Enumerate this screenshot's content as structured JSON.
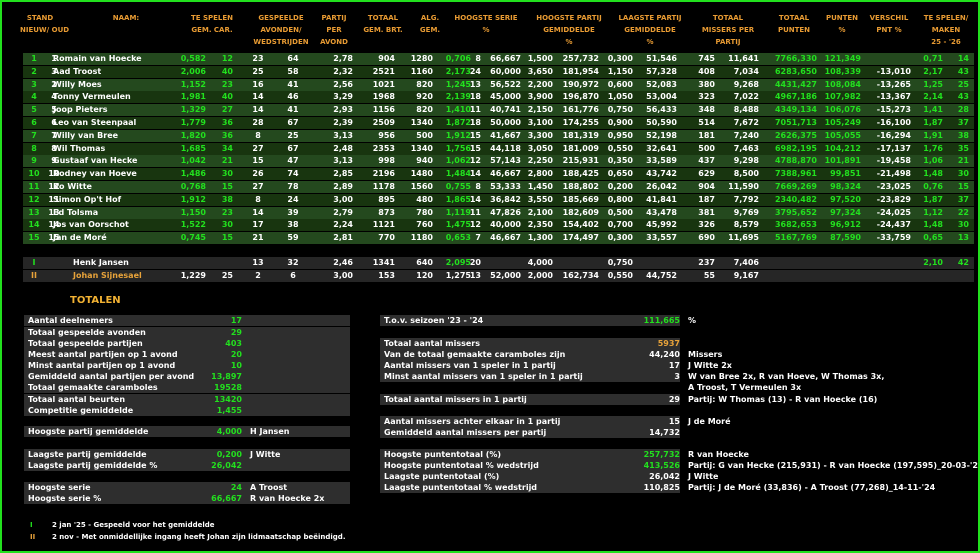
{
  "headers": {
    "stand": [
      "STAND",
      "NIEUW/ OUD"
    ],
    "naam": [
      "NAAM:"
    ],
    "te_spelen": [
      "TE SPELEN",
      "GEM.     CAR."
    ],
    "gespeelde": [
      "GESPEELDE",
      "AVONDEN/",
      "WEDSTRIJDEN"
    ],
    "partij": [
      "PARTIJ",
      "PER",
      "AVOND"
    ],
    "totaal": [
      "TOTAAL",
      "GEM.   BRT."
    ],
    "alg": [
      "ALG.",
      "GEM."
    ],
    "hoogste_serie": [
      "HOOGSTE SERIE",
      "%"
    ],
    "hoogste_partij": [
      "HOOGSTE PARTIJ",
      "GEMIDDELDE",
      "%"
    ],
    "laagste_partij": [
      "LAAGSTE PARTIJ",
      "GEMIDDELDE",
      "%"
    ],
    "totaal_missers": [
      "TOTAAL",
      "MISSERS    PER",
      "PARTIJ"
    ],
    "totaal_punten": [
      "TOTAAL",
      "PUNTEN"
    ],
    "punten_pct": [
      "PUNTEN",
      "%"
    ],
    "verschil": [
      "VERSCHIL",
      "PNT %"
    ],
    "te_spelen_maken": [
      "TE SPELEN/",
      "MAKEN",
      "25 - '26"
    ]
  },
  "players": [
    [
      "1",
      "1",
      "Romain van Hoecke",
      "0,582",
      "12",
      "23",
      "64",
      "2,78",
      "904",
      "1280",
      "0,706",
      "8",
      "66,667",
      "1,500",
      "257,732",
      "0,300",
      "51,546",
      "745",
      "11,641",
      "7766,330",
      "121,349",
      "",
      "0,71",
      "14"
    ],
    [
      "2",
      "3",
      "Aad Troost",
      "2,006",
      "40",
      "25",
      "58",
      "2,32",
      "2521",
      "1160",
      "2,173",
      "24",
      "60,000",
      "3,650",
      "181,954",
      "1,150",
      "57,328",
      "408",
      "7,034",
      "6283,650",
      "108,339",
      "-13,010",
      "2,17",
      "43"
    ],
    [
      "3",
      "2",
      "Willy Moes",
      "1,152",
      "23",
      "16",
      "41",
      "2,56",
      "1021",
      "820",
      "1,245",
      "13",
      "56,522",
      "2,200",
      "190,972",
      "0,600",
      "52,083",
      "380",
      "9,268",
      "4431,427",
      "108,084",
      "-13,265",
      "1,25",
      "25"
    ],
    [
      "4",
      "4",
      "Tonny Vermeulen",
      "1,981",
      "40",
      "14",
      "46",
      "3,29",
      "1968",
      "920",
      "2,139",
      "18",
      "45,000",
      "3,900",
      "196,870",
      "1,050",
      "53,004",
      "323",
      "7,022",
      "4967,186",
      "107,982",
      "-13,367",
      "2,14",
      "43"
    ],
    [
      "5",
      "5",
      "Joop Pieters",
      "1,329",
      "27",
      "14",
      "41",
      "2,93",
      "1156",
      "820",
      "1,410",
      "11",
      "40,741",
      "2,150",
      "161,776",
      "0,750",
      "56,433",
      "348",
      "8,488",
      "4349,134",
      "106,076",
      "-15,273",
      "1,41",
      "28"
    ],
    [
      "6",
      "6",
      "Leo van Steenpaal",
      "1,779",
      "36",
      "28",
      "67",
      "2,39",
      "2509",
      "1340",
      "1,872",
      "18",
      "50,000",
      "3,100",
      "174,255",
      "0,900",
      "50,590",
      "514",
      "7,672",
      "7051,713",
      "105,249",
      "-16,100",
      "1,87",
      "37"
    ],
    [
      "7",
      "7",
      "Willy van Bree",
      "1,820",
      "36",
      "8",
      "25",
      "3,13",
      "956",
      "500",
      "1,912",
      "15",
      "41,667",
      "3,300",
      "181,319",
      "0,950",
      "52,198",
      "181",
      "7,240",
      "2626,375",
      "105,055",
      "-16,294",
      "1,91",
      "38"
    ],
    [
      "8",
      "8",
      "Wil Thomas",
      "1,685",
      "34",
      "27",
      "67",
      "2,48",
      "2353",
      "1340",
      "1,756",
      "15",
      "44,118",
      "3,050",
      "181,009",
      "0,550",
      "32,641",
      "500",
      "7,463",
      "6982,195",
      "104,212",
      "-17,137",
      "1,76",
      "35"
    ],
    [
      "9",
      "9",
      "Gustaaf van Hecke",
      "1,042",
      "21",
      "15",
      "47",
      "3,13",
      "998",
      "940",
      "1,062",
      "12",
      "57,143",
      "2,250",
      "215,931",
      "0,350",
      "33,589",
      "437",
      "9,298",
      "4788,870",
      "101,891",
      "-19,458",
      "1,06",
      "21"
    ],
    [
      "10",
      "10",
      "Rodney van Hoeve",
      "1,486",
      "30",
      "26",
      "74",
      "2,85",
      "2196",
      "1480",
      "1,484",
      "14",
      "46,667",
      "2,800",
      "188,425",
      "0,650",
      "43,742",
      "629",
      "8,500",
      "7388,961",
      "99,851",
      "-21,498",
      "1,48",
      "30"
    ],
    [
      "11",
      "12",
      "Ko Witte",
      "0,768",
      "15",
      "27",
      "78",
      "2,89",
      "1178",
      "1560",
      "0,755",
      "8",
      "53,333",
      "1,450",
      "188,802",
      "0,200",
      "26,042",
      "904",
      "11,590",
      "7669,269",
      "98,324",
      "-23,025",
      "0,76",
      "15"
    ],
    [
      "12",
      "11",
      "Simon Op't Hof",
      "1,912",
      "38",
      "8",
      "24",
      "3,00",
      "895",
      "480",
      "1,865",
      "14",
      "36,842",
      "3,550",
      "185,669",
      "0,800",
      "41,841",
      "187",
      "7,792",
      "2340,482",
      "97,520",
      "-23,829",
      "1,87",
      "37"
    ],
    [
      "13",
      "13",
      "Ed Tolsma",
      "1,150",
      "23",
      "14",
      "39",
      "2,79",
      "873",
      "780",
      "1,119",
      "11",
      "47,826",
      "2,100",
      "182,609",
      "0,500",
      "43,478",
      "381",
      "9,769",
      "3795,652",
      "97,324",
      "-24,025",
      "1,12",
      "22"
    ],
    [
      "14",
      "14",
      "Jos van Oorschot",
      "1,522",
      "30",
      "17",
      "38",
      "2,24",
      "1121",
      "760",
      "1,475",
      "12",
      "40,000",
      "2,350",
      "154,402",
      "0,700",
      "45,992",
      "326",
      "8,579",
      "3682,653",
      "96,912",
      "-24,437",
      "1,48",
      "30"
    ],
    [
      "15",
      "15",
      "Jan de Moré",
      "0,745",
      "15",
      "21",
      "59",
      "2,81",
      "770",
      "1180",
      "0,653",
      "7",
      "46,667",
      "1,300",
      "174,497",
      "0,300",
      "33,557",
      "690",
      "11,695",
      "5167,769",
      "87,590",
      "-33,759",
      "0,65",
      "13"
    ]
  ],
  "guests": [
    [
      "I",
      "Henk Jansen",
      "",
      "",
      "13",
      "32",
      "2,46",
      "1341",
      "640",
      "2,095",
      "20",
      "",
      "4,000",
      "",
      "0,750",
      "",
      "237",
      "7,406",
      "",
      "",
      "",
      "2,10",
      "42"
    ],
    [
      "II",
      "Johan Sijnesael",
      "1,229",
      "25",
      "2",
      "6",
      "3,00",
      "153",
      "120",
      "1,275",
      "13",
      "52,000",
      "2,000",
      "162,734",
      "0,550",
      "44,752",
      "55",
      "9,167",
      "",
      "",
      "",
      "",
      ""
    ]
  ],
  "totalen_title": "TOTALEN",
  "stats_left": [
    {
      "label": "Aantal deelnemers",
      "value": "17",
      "extra": ""
    },
    {
      "label": "Totaal gespeelde avonden",
      "value": "29",
      "extra": ""
    },
    {
      "label": "Totaal gespeelde partijen",
      "value": "403",
      "extra": ""
    },
    {
      "label": "Meest aantal partijen op 1 avond",
      "value": "20",
      "extra": ""
    },
    {
      "label": "Minst aantal partijen op 1 avond",
      "value": "10",
      "extra": ""
    },
    {
      "label": "Gemiddeld aantal partijen per avond",
      "value": "13,897",
      "extra": ""
    },
    {
      "label": "Totaal gemaakte caramboles",
      "value": "19528",
      "extra": ""
    },
    {
      "label": "Totaal aantal beurten",
      "value": "13420",
      "extra": ""
    },
    {
      "label": "Competitie gemiddelde",
      "value": "1,455",
      "extra": ""
    },
    {
      "label": "Hoogste partij gemiddelde",
      "value": "4,000",
      "extra": "H Jansen"
    },
    {
      "label": "Laagste partij gemiddelde",
      "value": "0,200",
      "extra": "J Witte"
    },
    {
      "label": "Laagste partij gemiddelde %",
      "value": "26,042",
      "extra": ""
    },
    {
      "label": "Hoogste serie",
      "value": "24",
      "extra": "A Troost"
    },
    {
      "label": "Hoogste serie %",
      "value": "66,667",
      "extra": "R van Hoecke 2x"
    }
  ],
  "stats_right": [
    {
      "label": "T.o.v. seizoen '23 - '24",
      "value": "111,665",
      "extra": "%"
    },
    {
      "label": "Totaal aantal missers",
      "value": "5937",
      "extra": ""
    },
    {
      "label": "Van de totaal gemaakte caramboles zijn",
      "value": "44,240",
      "extra": "Missers"
    },
    {
      "label": "Aantal missers van 1 speler in 1 partij",
      "value": "17",
      "extra": "J Witte 2x"
    },
    {
      "label": "Minst aantal missers van 1 speler in 1 partij",
      "value": "3",
      "extra": "W van Bree 2x, R van Hoeve, W Thomas 3x,"
    },
    {
      "label": "",
      "value": "",
      "extra": "A Troost, T Vermeulen 3x"
    },
    {
      "label": "Totaal aantal missers in 1 partij",
      "value": "29",
      "extra": "Partij: W Thomas (13) - R van Hoecke (16)"
    },
    {
      "label": "Aantal missers achter elkaar in 1 partij",
      "value": "15",
      "extra": "J de Moré"
    },
    {
      "label": "Gemiddeld aantal missers per partij",
      "value": "14,732",
      "extra": ""
    },
    {
      "label": "Hoogste puntentotaal (%)",
      "value": "257,732",
      "extra": "R van Hoecke"
    },
    {
      "label": "Hoogste puntentotaal % wedstrijd",
      "value": "413,526",
      "extra": "Partij: G van Hecke (215,931) - R van Hoecke (197,595)_20-03-'25"
    },
    {
      "label": "Laagste puntentotaal (%)",
      "value": "26,042",
      "extra": "J Witte"
    },
    {
      "label": "Laagste puntentotaal % wedstrijd",
      "value": "110,825",
      "extra": "Partij: J de Moré (33,836) - A Troost (77,268)_14-11-'24"
    }
  ],
  "notes": [
    {
      "mark": "I",
      "text": "2 jan '25 - Gespeeld voor het gemiddelde"
    },
    {
      "mark": "II",
      "text": "2 nov - Met onmiddellijke ingang heeft Johan zijn lidmaatschap beëindigd."
    }
  ],
  "colors": {
    "background": "#000000",
    "frame": "#22e01e",
    "header": "#e89b33",
    "green": "#22e01e",
    "orange": "#e8a33a",
    "row_even": "#24491e",
    "row_odd": "#18350f"
  }
}
